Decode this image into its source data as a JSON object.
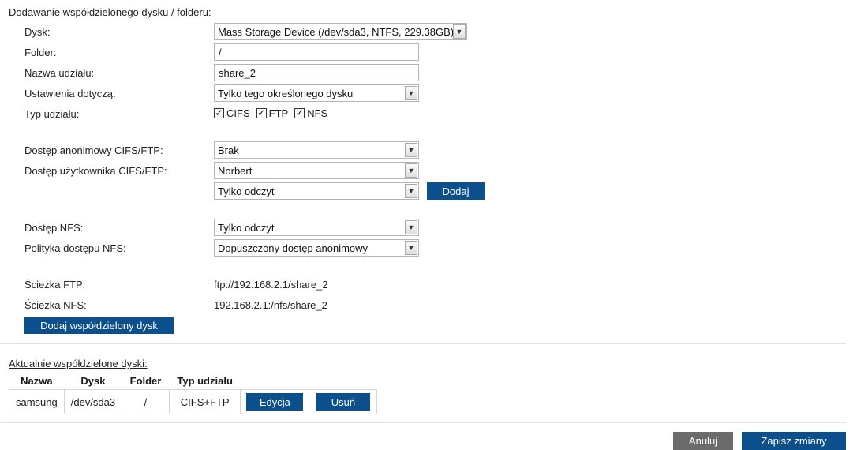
{
  "add_section": {
    "title": "Dodawanie współdzielonego dysku / folderu:",
    "disk_label": "Dysk:",
    "disk_value": "Mass Storage Device (/dev/sda3, NTFS, 229.38GB)",
    "folder_label": "Folder:",
    "folder_value": "/",
    "share_name_label": "Nazwa udziału:",
    "share_name_value": "share_2",
    "settings_label": "Ustawienia dotyczą:",
    "settings_value": "Tylko tego określonego dysku",
    "share_type_label": "Typ udziału:",
    "share_types": [
      {
        "label": "CIFS",
        "checked": true
      },
      {
        "label": "FTP",
        "checked": true
      },
      {
        "label": "NFS",
        "checked": true
      }
    ],
    "anon_access_label": "Dostęp anonimowy CIFS/FTP:",
    "anon_access_value": "Brak",
    "user_access_label": "Dostęp użytkownika CIFS/FTP:",
    "user_value": "Norbert",
    "user_permission_value": "Tylko odczyt",
    "add_user_button": "Dodaj",
    "nfs_access_label": "Dostęp NFS:",
    "nfs_access_value": "Tylko odczyt",
    "nfs_policy_label": "Polityka dostępu NFS:",
    "nfs_policy_value": "Dopuszczony dostęp anonimowy",
    "ftp_path_label": "Ścieżka FTP:",
    "ftp_path_value": "ftp://192.168.2.1/share_2",
    "nfs_path_label": "Ścieżka NFS:",
    "nfs_path_value": "192.168.2.1:/nfs/share_2",
    "add_share_button": "Dodaj współdzielony dysk"
  },
  "current_section": {
    "title": "Aktualnie współdzielone dyski:",
    "columns": [
      "Nazwa",
      "Dysk",
      "Folder",
      "Typ udziału"
    ],
    "rows": [
      {
        "name": "samsung",
        "disk": "/dev/sda3",
        "folder": "/",
        "type": "CIFS+FTP",
        "edit_label": "Edycja",
        "delete_label": "Usuń"
      }
    ]
  },
  "footer": {
    "cancel_button": "Anuluj",
    "save_button": "Zapisz zmiany"
  },
  "colors": {
    "primary_button": "#0b4f8c",
    "secondary_button": "#6b6b6b"
  }
}
